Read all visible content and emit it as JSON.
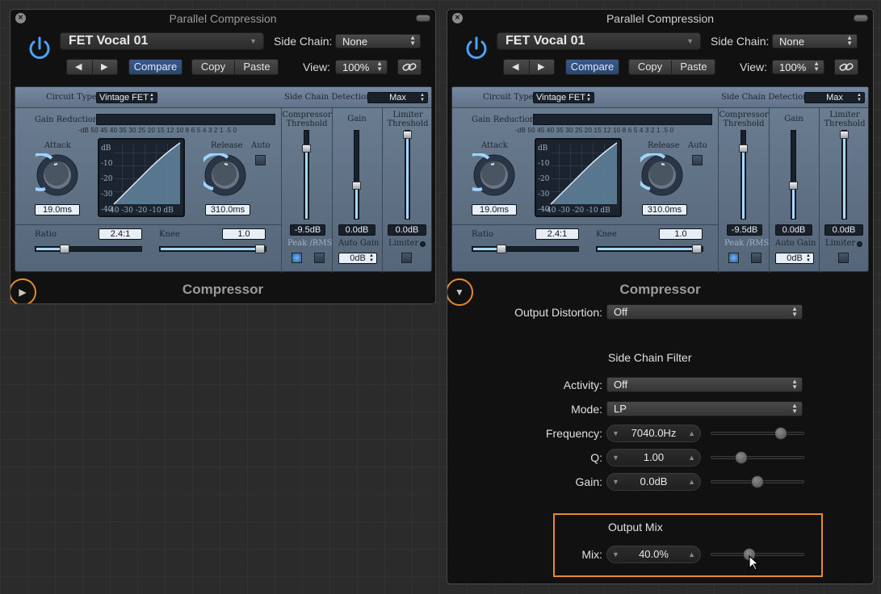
{
  "windows": [
    {
      "title": "Parallel Compression",
      "preset": "FET Vocal 01",
      "side_chain_label": "Side Chain:",
      "side_chain_value": "None",
      "view_label": "View:",
      "view_value": "100%",
      "compare_label": "Compare",
      "copy_label": "Copy",
      "paste_label": "Paste",
      "plugin_name": "Compressor",
      "expanded": false
    },
    {
      "title": "Parallel Compression",
      "preset": "FET Vocal 01",
      "side_chain_label": "Side Chain:",
      "side_chain_value": "None",
      "view_label": "View:",
      "view_value": "100%",
      "compare_label": "Compare",
      "copy_label": "Copy",
      "paste_label": "Paste",
      "plugin_name": "Compressor",
      "expanded": true
    }
  ],
  "compressor": {
    "circuit_type_label": "Circuit Type",
    "circuit_type_value": "Vintage FET",
    "side_chain_detection_label": "Side Chain Detection",
    "side_chain_detection_value": "Max",
    "gain_reduction_label": "Gain Reduction",
    "gr_scale": "-dB 50 45 40 35 30 25 20 15 12 10  8  6  5  4  3  2  1  .5  0",
    "attack_label": "Attack",
    "attack_value": "19.0ms",
    "release_label": "Release",
    "release_value": "310.0ms",
    "auto_label": "Auto",
    "graph_db_labels": [
      "dB",
      "-10",
      "-20",
      "-30",
      "-40"
    ],
    "graph_x_labels": "-40 -30 -20 -10  dB",
    "ratio_label": "Ratio",
    "ratio_value": "2.4:1",
    "knee_label": "Knee",
    "knee_value": "1.0",
    "threshold_label_1": "Compressor",
    "threshold_label_2": "Threshold",
    "threshold_value": "-9.5dB",
    "peak_rms_label": "Peak /RMS",
    "gain_label": "Gain",
    "gain_value": "0.0dB",
    "auto_gain_label": "Auto Gain",
    "auto_gain_value": "0dB",
    "limiter_label_1": "Limiter",
    "limiter_label_2": "Threshold",
    "limiter_value": "0.0dB",
    "limiter_toggle_label": "Limiter"
  },
  "extended": {
    "output_distortion_label": "Output Distortion:",
    "output_distortion_value": "Off",
    "side_chain_filter_heading": "Side Chain Filter",
    "activity_label": "Activity:",
    "activity_value": "Off",
    "mode_label": "Mode:",
    "mode_value": "LP",
    "frequency_label": "Frequency:",
    "frequency_value": "7040.0Hz",
    "q_label": "Q:",
    "q_value": "1.00",
    "gain_label": "Gain:",
    "gain_value": "0.0dB",
    "output_mix_heading": "Output Mix",
    "mix_label": "Mix:",
    "mix_value": "40.0%",
    "frequency_level": 0.8,
    "q_level": 0.3,
    "gain_level": 0.5,
    "mix_level": 0.4
  },
  "colors": {
    "highlight": "#e58b2b",
    "accent": "#a8d8ff"
  }
}
